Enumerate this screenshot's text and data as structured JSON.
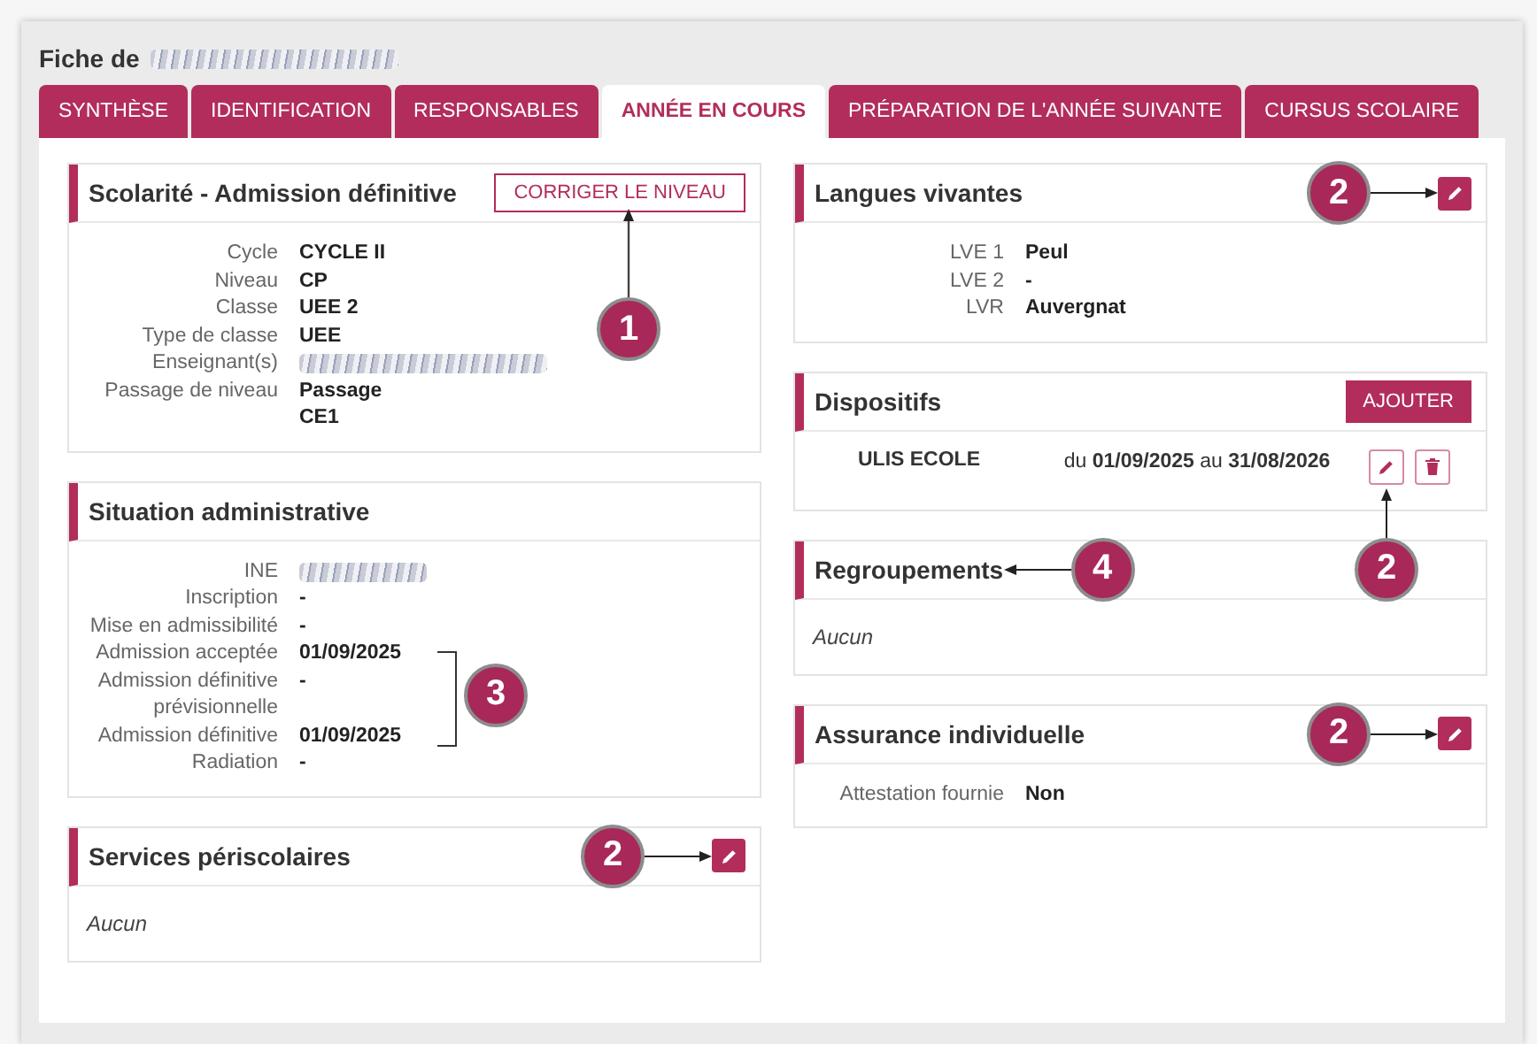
{
  "page_title": "Fiche de",
  "tabs": [
    {
      "label": "SYNTHÈSE",
      "selected": false
    },
    {
      "label": "IDENTIFICATION",
      "selected": false
    },
    {
      "label": "RESPONSABLES",
      "selected": false
    },
    {
      "label": "ANNÉE EN COURS",
      "selected": true
    },
    {
      "label": "PRÉPARATION DE L'ANNÉE SUIVANTE",
      "selected": false
    },
    {
      "label": "CURSUS SCOLAIRE",
      "selected": false
    }
  ],
  "columns": [
    {
      "cards": [
        {
          "title": "Scolarité - Admission définitive",
          "kind": "fields",
          "action": {
            "kind": "outline",
            "label": "CORRIGER LE NIVEAU"
          },
          "callout": {
            "number": "1",
            "kind": "below-action"
          },
          "groups": [
            {
              "fields": [
                {
                  "label": "Cycle",
                  "value": "CYCLE II",
                  "kind": "text"
                },
                {
                  "label": "Niveau",
                  "value": "CP",
                  "kind": "text"
                },
                {
                  "label": "Classe",
                  "value": "UEE 2",
                  "kind": "text"
                },
                {
                  "label": "Type de classe",
                  "value": "UEE",
                  "kind": "text"
                },
                {
                  "label": "Enseignant(s)",
                  "kind": "redacted"
                },
                {
                  "label": "Passage de niveau",
                  "value": "Passage CE1",
                  "kind": "text"
                }
              ]
            }
          ]
        },
        {
          "title": "Situation administrative",
          "kind": "fields",
          "groups": [
            {
              "fields": [
                {
                  "label": "INE",
                  "kind": "redacted"
                },
                {
                  "label": "Inscription",
                  "value": "-",
                  "kind": "text"
                },
                {
                  "label": "Mise en admissibilité",
                  "value": "-",
                  "kind": "text"
                }
              ]
            },
            {
              "callout": {
                "number": "3",
                "kind": "bracket"
              },
              "fields": [
                {
                  "label": "Admission acceptée",
                  "value": "01/09/2025",
                  "kind": "text"
                },
                {
                  "label": "Admission définitive prévisionnelle",
                  "value": "-",
                  "kind": "text"
                },
                {
                  "label": "Admission définitive",
                  "value": "01/09/2025",
                  "kind": "text"
                }
              ]
            },
            {
              "fields": [
                {
                  "label": "Radiation",
                  "value": "-",
                  "kind": "text"
                }
              ]
            }
          ]
        },
        {
          "title": "Services périscolaires",
          "kind": "empty",
          "action": {
            "kind": "edit"
          },
          "callout": {
            "number": "2",
            "kind": "before-action"
          },
          "empty_text": "Aucun"
        }
      ]
    },
    {
      "cards": [
        {
          "title": "Langues vivantes",
          "kind": "fields",
          "action": {
            "kind": "edit"
          },
          "callout": {
            "number": "2",
            "kind": "before-action"
          },
          "groups": [
            {
              "fields": [
                {
                  "label": "LVE 1",
                  "value": "Peul",
                  "kind": "text"
                },
                {
                  "label": "LVE 2",
                  "value": "-",
                  "kind": "text"
                },
                {
                  "label": "LVR",
                  "value": "Auvergnat",
                  "kind": "text"
                }
              ]
            }
          ]
        },
        {
          "title": "Dispositifs",
          "kind": "items",
          "action": {
            "kind": "solid",
            "label": "AJOUTER"
          },
          "items": [
            {
              "name": "ULIS ECOLE",
              "period": "du **01/09/2025** au **31/08/2026**",
              "callout": {
                "number": "2",
                "kind": "below-edit"
              }
            }
          ]
        },
        {
          "title": "Regroupements",
          "kind": "empty",
          "callout": {
            "number": "4",
            "kind": "after-title"
          },
          "empty_text": "Aucun"
        },
        {
          "title": "Assurance individuelle",
          "kind": "fields",
          "action": {
            "kind": "edit"
          },
          "callout": {
            "number": "2",
            "kind": "before-action"
          },
          "groups": [
            {
              "fields": [
                {
                  "label": "Attestation fournie",
                  "value": "Non",
                  "kind": "text"
                }
              ]
            }
          ]
        }
      ]
    }
  ]
}
